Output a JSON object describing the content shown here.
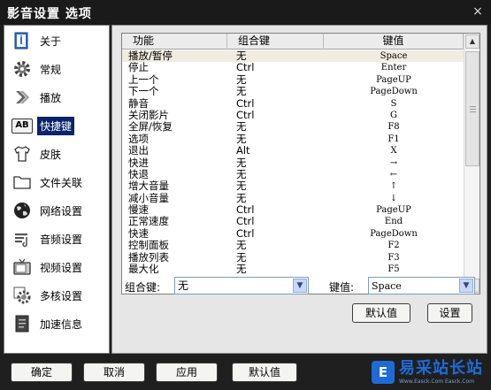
{
  "window": {
    "title": "影音设置 选项",
    "close_glyph": "×"
  },
  "sidebar": {
    "items": [
      {
        "label": "关于",
        "icon": "info-book-icon"
      },
      {
        "label": "常规",
        "icon": "gear-icon"
      },
      {
        "label": "播放",
        "icon": "play-arrow-icon"
      },
      {
        "label": "快捷键",
        "icon": "keyboard-ab-icon",
        "active": true
      },
      {
        "label": "皮肤",
        "icon": "tshirt-icon"
      },
      {
        "label": "文件关联",
        "icon": "folder-icon"
      },
      {
        "label": "网络设置",
        "icon": "globe-icon"
      },
      {
        "label": "音频设置",
        "icon": "audio-bars-icon"
      },
      {
        "label": "视频设置",
        "icon": "tv-icon"
      },
      {
        "label": "多核设置",
        "icon": "multicore-gear-icon"
      },
      {
        "label": "加速信息",
        "icon": "document-icon"
      }
    ]
  },
  "ab_icon_text": "AB",
  "shortcuts": {
    "headers": [
      "功能",
      "组合键",
      "键值"
    ],
    "rows": [
      [
        "播放/暂停",
        "无",
        "Space"
      ],
      [
        "停止",
        "Ctrl",
        "Enter"
      ],
      [
        "上一个",
        "无",
        "PageUP"
      ],
      [
        "下一个",
        "无",
        "PageDown"
      ],
      [
        "静音",
        "Ctrl",
        "S"
      ],
      [
        "关闭影片",
        "Ctrl",
        "G"
      ],
      [
        "全屏/恢复",
        "无",
        "F8"
      ],
      [
        "选项",
        "无",
        "F1"
      ],
      [
        "退出",
        "Alt",
        "X"
      ],
      [
        "快进",
        "无",
        "→"
      ],
      [
        "快退",
        "无",
        "←"
      ],
      [
        "增大音量",
        "无",
        "↑"
      ],
      [
        "减小音量",
        "无",
        "↓"
      ],
      [
        "慢速",
        "Ctrl",
        "PageUP"
      ],
      [
        "正常速度",
        "Ctrl",
        "End"
      ],
      [
        "快速",
        "Ctrl",
        "PageDown"
      ],
      [
        "控制面板",
        "无",
        "F2"
      ],
      [
        "播放列表",
        "无",
        "F3"
      ],
      [
        "最大化",
        "无",
        "F5"
      ]
    ],
    "selected_row": 0
  },
  "scroll": {
    "up": "▲",
    "down": "▼"
  },
  "editor": {
    "modifier_label": "组合键:",
    "modifier_value": "无",
    "key_label": "键值:",
    "key_value": "Space",
    "arrow": "▼",
    "default_button": "默认值",
    "set_button": "设置"
  },
  "footer": {
    "ok": "确定",
    "cancel": "取消",
    "apply": "应用",
    "defaults": "默认值"
  },
  "watermark": {
    "mark": "E",
    "title": "易采站长站",
    "subtitle": "Www.Easck.Com  Easck.Com"
  }
}
